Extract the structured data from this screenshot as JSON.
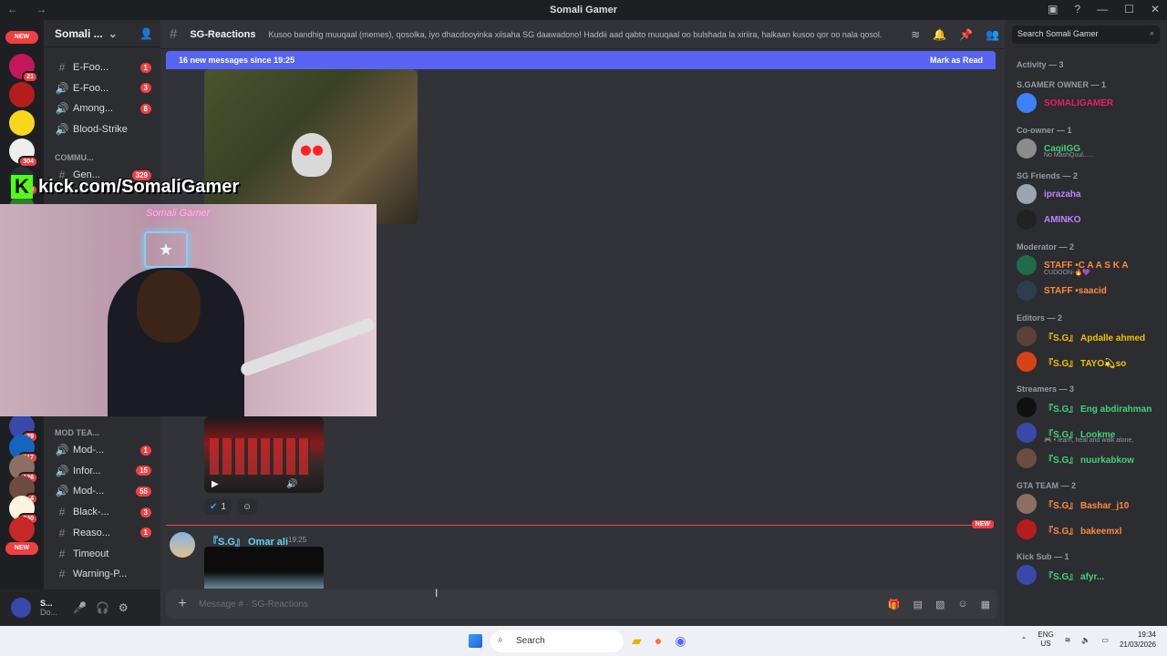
{
  "window": {
    "title": "Somali Gamer"
  },
  "guild": {
    "name": "Somali ..."
  },
  "servers": [
    {
      "badge": "NEW",
      "type": "pill"
    },
    {
      "badge": "21",
      "color": "#c2185b"
    },
    {
      "badge": "",
      "color": "#b71c1c"
    },
    {
      "badge": "",
      "color": "#f9d71c"
    },
    {
      "badge": "304",
      "color": "#eeeeee"
    },
    {
      "badge": "48",
      "color": "#263238"
    },
    {
      "badge": "",
      "color": "#2e7d32"
    }
  ],
  "servers_bottom": [
    {
      "badge": "29",
      "color": "#3949ab"
    },
    {
      "badge": "317",
      "color": "#1565c0"
    },
    {
      "badge": "126",
      "color": "#8d6e63"
    },
    {
      "badge": "4",
      "color": "#6d4c41"
    },
    {
      "badge": "240",
      "color": "#fff3e0"
    },
    {
      "badge": "",
      "color": "#c62828"
    },
    {
      "badge": "NEW",
      "type": "pill"
    }
  ],
  "channels_top": [
    {
      "icon": "#",
      "label": "E-Foo...",
      "count": "1"
    },
    {
      "icon": "🔊",
      "label": "E-Foo...",
      "count": "3"
    },
    {
      "icon": "🔊",
      "label": "Among...",
      "count": "8"
    },
    {
      "icon": "🔊",
      "label": "Blood-Strike",
      "count": ""
    }
  ],
  "category_community": "COMMU...",
  "channel_gen": {
    "label": "Gen...",
    "count": "329"
  },
  "category_mod": "MOD TEA...",
  "channels_bottom": [
    {
      "icon": "🔊",
      "label": "Mod-...",
      "count": "1"
    },
    {
      "icon": "🔊",
      "label": "Infor...",
      "count": "15"
    },
    {
      "icon": "🔊",
      "label": "Mod-...",
      "count": "55"
    },
    {
      "icon": "#",
      "label": "Black-...",
      "count": "3"
    },
    {
      "icon": "#",
      "label": "Reaso...",
      "count": "1"
    },
    {
      "icon": "#",
      "label": "Timeout",
      "count": ""
    },
    {
      "icon": "#",
      "label": "Warning-P...",
      "count": ""
    }
  ],
  "user": {
    "name": "S...",
    "status": "Do..."
  },
  "channel": {
    "name": "SG-Reactions",
    "topic": "Kusoo bandhig muuqaal (memes), qosolka, iyo dhacdooyinka xiisaha SG daawadono! Haddii aad qabto muuqaal oo bulshada la xiriira, halkaan kusoo qor oo nala qosol."
  },
  "new_messages": {
    "text": "16 new messages since 19:25",
    "action": "Mark as Read"
  },
  "reaction": {
    "count": "1"
  },
  "divider_tag": "NEW",
  "message": {
    "author": "『S.G』 Omar ali",
    "time": "19:25"
  },
  "composer": {
    "placeholder": "Message # · SG-Reactions"
  },
  "overlay": {
    "kick_url": "kick.com/SomaliGamer",
    "neon": "Somali Gamer"
  },
  "members_search": "Search Somali Gamer",
  "member_groups": [
    {
      "title": "Activity — 3",
      "members": []
    },
    {
      "title": "S.GAMER OWNER — 1",
      "members": [
        {
          "name": "SOMALIGAMER",
          "color": "#e91e63",
          "status": ""
        }
      ]
    },
    {
      "title": "Co-owner — 1",
      "members": [
        {
          "name": "CaqiIGG",
          "color": "#43d17a",
          "status": "No MashQuul......"
        }
      ]
    },
    {
      "title": "SG Friends — 2",
      "members": [
        {
          "name": "iprazaha",
          "color": "#c084fc",
          "status": ""
        },
        {
          "name": "AMINKO",
          "color": "#c084fc",
          "status": ""
        }
      ]
    },
    {
      "title": "Moderator — 2",
      "members": [
        {
          "name": "STAFF •C A A S K A",
          "color": "#ff8a3d",
          "status": "CUDOON-🔥💜"
        },
        {
          "name": "STAFF •saacid",
          "color": "#ff8a3d",
          "status": ""
        }
      ]
    },
    {
      "title": "Editors — 2",
      "members": [
        {
          "name": "『S.G』 Apdalle ahmed",
          "color": "#f0c000",
          "status": ""
        },
        {
          "name": "『S.G』 TAYO💫so",
          "color": "#f0c000",
          "status": ""
        }
      ]
    },
    {
      "title": "Streamers — 3",
      "members": [
        {
          "name": "『S.G』 Eng abdirahman",
          "color": "#43d17a",
          "status": ""
        },
        {
          "name": "『S.G』 Lookme",
          "color": "#43d17a",
          "status": "🎮 • learn, heal and walk alone,"
        },
        {
          "name": "『S.G』 nuurkabkow",
          "color": "#43d17a",
          "status": ""
        }
      ]
    },
    {
      "title": "GTA TEAM — 2",
      "members": [
        {
          "name": "『S.G』 Bashar_j10",
          "color": "#ff8a3d",
          "status": ""
        },
        {
          "name": "『S.G』 bakeemxl",
          "color": "#ff8a3d",
          "status": ""
        }
      ]
    },
    {
      "title": "Kick Sub — 1",
      "members": [
        {
          "name": "『S.G』 afyr...",
          "color": "#43d17a",
          "status": ""
        }
      ]
    }
  ],
  "taskbar": {
    "search": "Search",
    "lang": "ENG",
    "region": "US",
    "time": "19:34",
    "date": "21/03/2026"
  }
}
